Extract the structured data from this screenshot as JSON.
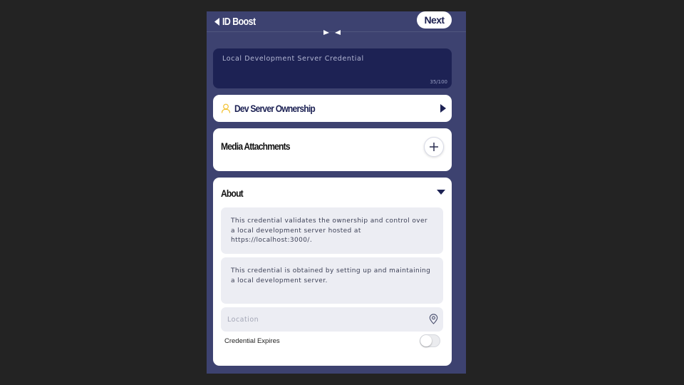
{
  "header": {
    "back_label": "ID Boost",
    "next_label": "Next"
  },
  "title_field": {
    "value": "Local Development Server Credential",
    "counter": "35/100"
  },
  "ownership": {
    "label": "Dev Server Ownership"
  },
  "media": {
    "label": "Media Attachments"
  },
  "about": {
    "label": "About",
    "description": "This credential validates the ownership and control over a local development server hosted at https://localhost:3000/.",
    "criteria": "This credential is obtained by setting up and maintaining a local development server.",
    "location_placeholder": "Location",
    "expires_label": "Credential Expires",
    "expires_enabled": false
  },
  "colors": {
    "background": "#232323",
    "panel": "#3d4270",
    "navy": "#1d2254",
    "accent_yellow": "#f2c12e",
    "field_bg": "#ecedf3"
  },
  "icons": [
    "back-caret-icon",
    "user-icon",
    "chevron-right-icon",
    "plus-icon",
    "caret-down-icon",
    "map-pin-icon"
  ]
}
